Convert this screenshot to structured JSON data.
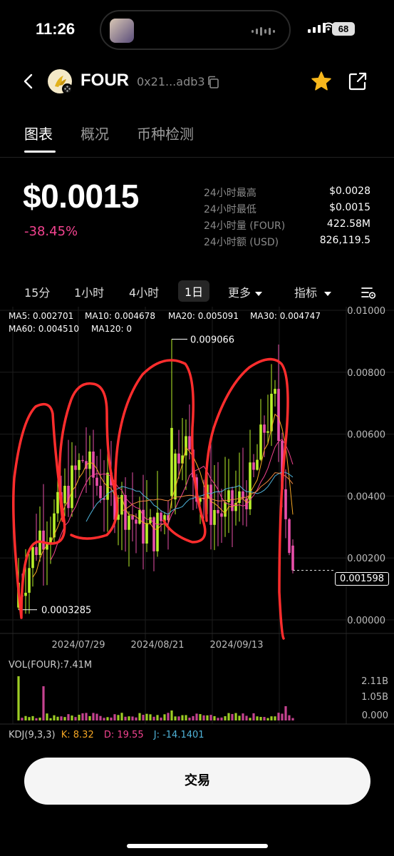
{
  "status_bar": {
    "time": "11:26",
    "battery": "68"
  },
  "header": {
    "token_name": "FOUR",
    "address": "0x21...adb3"
  },
  "tabs": [
    {
      "label": "图表",
      "active": true
    },
    {
      "label": "概况",
      "active": false
    },
    {
      "label": "币种检测",
      "active": false
    }
  ],
  "price": {
    "value": "$0.0015",
    "change": "-38.45%"
  },
  "stats": [
    {
      "label": "24小时最高",
      "value": "$0.0028"
    },
    {
      "label": "24小时最低",
      "value": "$0.0015"
    },
    {
      "label": "24小时量 (FOUR)",
      "value": "422.58M"
    },
    {
      "label": "24小时额 (USD)",
      "value": "826,119.5"
    }
  ],
  "intervals": {
    "items": [
      {
        "label": "15分"
      },
      {
        "label": "1小时"
      },
      {
        "label": "4小时"
      },
      {
        "label": "1日",
        "active": true
      }
    ],
    "more": "更多",
    "indicator": "指标"
  },
  "ma": [
    {
      "label": "MA5: 0.002701",
      "color": "#f5a623"
    },
    {
      "label": "MA10: 0.004678",
      "color": "#f2438f"
    },
    {
      "label": "MA20: 0.005091",
      "color": "#4fb3d9"
    },
    {
      "label": "MA30: 0.004747",
      "color": "#f0883e"
    },
    {
      "label": "MA60: 0.004510",
      "color": "#b36bd8"
    },
    {
      "label": "MA120: 0",
      "color": "#6cc04a"
    }
  ],
  "chart_data": {
    "type": "candlestick",
    "y_ticks": [
      "0.01000",
      "0.00800",
      "0.00600",
      "0.00400",
      "0.00200",
      "0.00000"
    ],
    "ylim": [
      0,
      0.01
    ],
    "x_ticks": [
      "2024/07/29",
      "2024/08/21",
      "2024/09/13"
    ],
    "high_label": "0.009066",
    "low_label": "0.0003285",
    "last_price": "0.001598",
    "colors": {
      "up": "#b8f02a",
      "down": "#e84fa9",
      "annotation": "#ff2d2d"
    }
  },
  "volume": {
    "label": "VOL(FOUR):7.41M",
    "ticks": [
      "2.11B",
      "1.05B",
      "0.000"
    ]
  },
  "kdj": {
    "prefix": "KDJ(9,3,3)",
    "k": "K: 8.32",
    "d": "D: 19.55",
    "j": "J: -14.1401"
  },
  "trade_button": "交易"
}
